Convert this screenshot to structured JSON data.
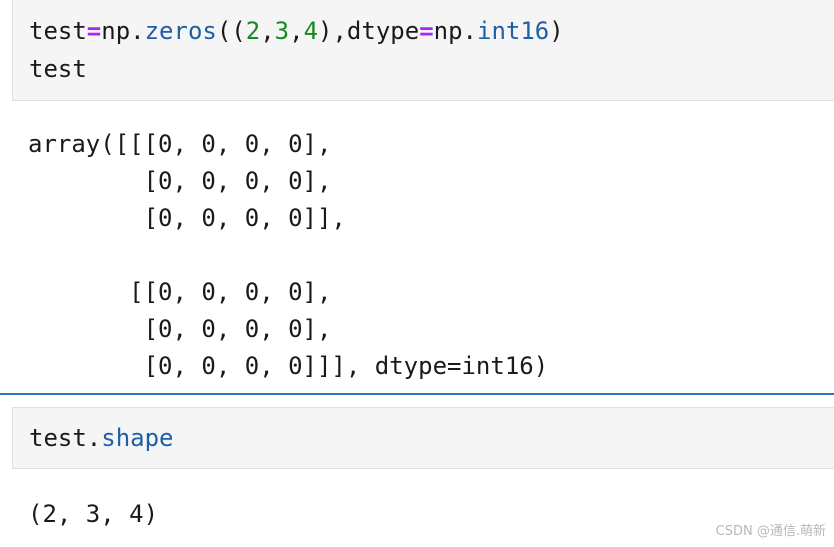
{
  "cells": [
    {
      "input": {
        "line1": {
          "var": "test",
          "eq": "=",
          "mod": "np.",
          "fn": "zeros",
          "open": "((",
          "n1": "2",
          "c1": ",",
          "n2": "3",
          "c2": ",",
          "n3": "4",
          "mid": "),dtype",
          "eq2": "=",
          "mod2": "np.",
          "type": "int16",
          "close": ")"
        },
        "line2": "test"
      },
      "output": "array([[[0, 0, 0, 0],\n        [0, 0, 0, 0],\n        [0, 0, 0, 0]],\n\n       [[0, 0, 0, 0],\n        [0, 0, 0, 0],\n        [0, 0, 0, 0]]], dtype=int16)"
    },
    {
      "input": {
        "var": "test.",
        "attr": "shape"
      },
      "output": "(2, 3, 4)"
    }
  ],
  "watermark": "CSDN @通信.萌新"
}
